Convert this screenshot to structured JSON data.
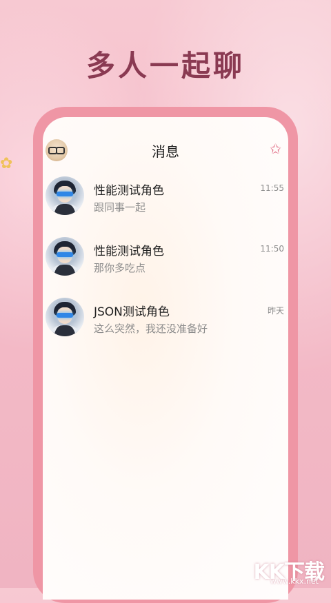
{
  "headline": "多人一起聊",
  "screen": {
    "title": "消息"
  },
  "chats": [
    {
      "name": "性能测试角色",
      "preview": "跟同事一起",
      "time": "11:55"
    },
    {
      "name": "性能测试角色",
      "preview": "那你多吃点",
      "time": "11:50"
    },
    {
      "name": "JSON测试角色",
      "preview": "这么突然，我还没准备好",
      "time": "昨天"
    }
  ],
  "watermark": {
    "big": "KK下载",
    "small": "www.kkx.net"
  },
  "colors": {
    "accent": "#ef96a5",
    "headline": "#8a3a52",
    "star": "#e06b84"
  },
  "icons": {
    "profile": "user-avatar-icon",
    "favorite": "star-icon"
  }
}
